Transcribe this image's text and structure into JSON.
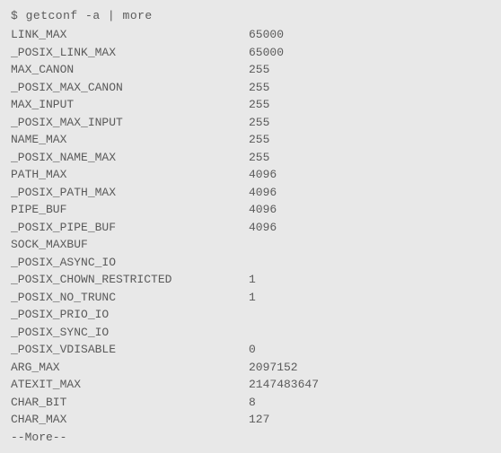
{
  "command": "$ getconf -a | more",
  "rows": [
    {
      "name": "LINK_MAX",
      "value": "65000"
    },
    {
      "name": "_POSIX_LINK_MAX",
      "value": "65000"
    },
    {
      "name": "MAX_CANON",
      "value": "255"
    },
    {
      "name": "_POSIX_MAX_CANON",
      "value": "255"
    },
    {
      "name": "MAX_INPUT",
      "value": "255"
    },
    {
      "name": "_POSIX_MAX_INPUT",
      "value": "255"
    },
    {
      "name": "NAME_MAX",
      "value": "255"
    },
    {
      "name": "_POSIX_NAME_MAX",
      "value": "255"
    },
    {
      "name": "PATH_MAX",
      "value": "4096"
    },
    {
      "name": "_POSIX_PATH_MAX",
      "value": "4096"
    },
    {
      "name": "PIPE_BUF",
      "value": "4096"
    },
    {
      "name": "_POSIX_PIPE_BUF",
      "value": "4096"
    },
    {
      "name": "SOCK_MAXBUF",
      "value": ""
    },
    {
      "name": "_POSIX_ASYNC_IO",
      "value": ""
    },
    {
      "name": "_POSIX_CHOWN_RESTRICTED",
      "value": "1"
    },
    {
      "name": "_POSIX_NO_TRUNC",
      "value": "1"
    },
    {
      "name": "_POSIX_PRIO_IO",
      "value": ""
    },
    {
      "name": "_POSIX_SYNC_IO",
      "value": ""
    },
    {
      "name": "_POSIX_VDISABLE",
      "value": "0"
    },
    {
      "name": "ARG_MAX",
      "value": "2097152"
    },
    {
      "name": "ATEXIT_MAX",
      "value": "2147483647"
    },
    {
      "name": "CHAR_BIT",
      "value": "8"
    },
    {
      "name": "CHAR_MAX",
      "value": "127"
    }
  ],
  "more_prompt": "--More--"
}
